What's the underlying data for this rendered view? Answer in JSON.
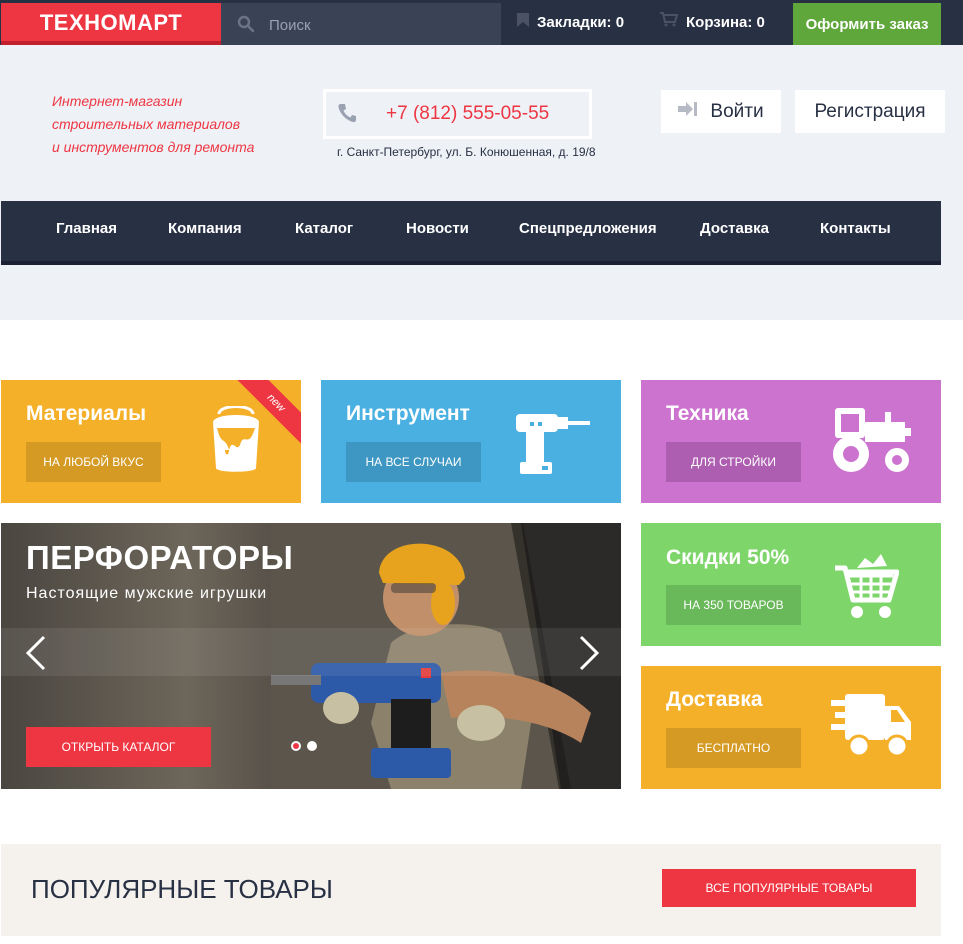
{
  "topbar": {
    "logo": "ТЕХНОМАРТ",
    "search_placeholder": "Поиск",
    "bookmarks": "Закладки: 0",
    "cart": "Корзина: 0",
    "order": "Оформить заказ"
  },
  "header": {
    "tagline": [
      "Интернет-магазин",
      "строительных материалов",
      "и инструментов для ремонта"
    ],
    "phone": "+7 (812) 555-05-55",
    "address": "г. Санкт-Петербург, ул. Б. Конюшенная, д. 19/8",
    "login": "Войти",
    "register": "Регистрация"
  },
  "nav": [
    "Главная",
    "Компания",
    "Каталог",
    "Новости",
    "Спецпредложения",
    "Доставка",
    "Контакты"
  ],
  "tiles": {
    "materials": {
      "title": "Материалы",
      "button": "НА ЛЮБОЙ ВКУС",
      "badge": "new",
      "icon": "paint-bucket-icon"
    },
    "tools": {
      "title": "Инструмент",
      "button": "НА ВСЕ СЛУЧАИ",
      "icon": "drill-icon"
    },
    "machines": {
      "title": "Техника",
      "button": "ДЛЯ СТРОЙКИ",
      "icon": "tractor-icon"
    },
    "sale": {
      "title": "Скидки 50%",
      "button": "НА 350 ТОВАРОВ",
      "icon": "cart-icon"
    },
    "delivery": {
      "title": "Доставка",
      "button": "БЕСПЛАТНО",
      "icon": "truck-icon"
    }
  },
  "slider": {
    "title": "ПЕРФОРАТОРЫ",
    "subtitle": "Настоящие мужские игрушки",
    "button": "ОТКРЫТЬ КАТАЛОГ",
    "slides": 2,
    "active_slide": 1
  },
  "popular": {
    "title": "ПОПУЛЯРНЫЕ ТОВАРЫ",
    "button": "ВСЕ ПОПУЛЯРНЫЕ ТОВАРЫ"
  },
  "colors": {
    "brand_red": "#ee3643",
    "dark": "#283044",
    "green": "#5fa63b",
    "yellow": "#f5b02a",
    "blue": "#4ab0e1",
    "purple": "#cc72cf",
    "light_green": "#7ed66b"
  }
}
